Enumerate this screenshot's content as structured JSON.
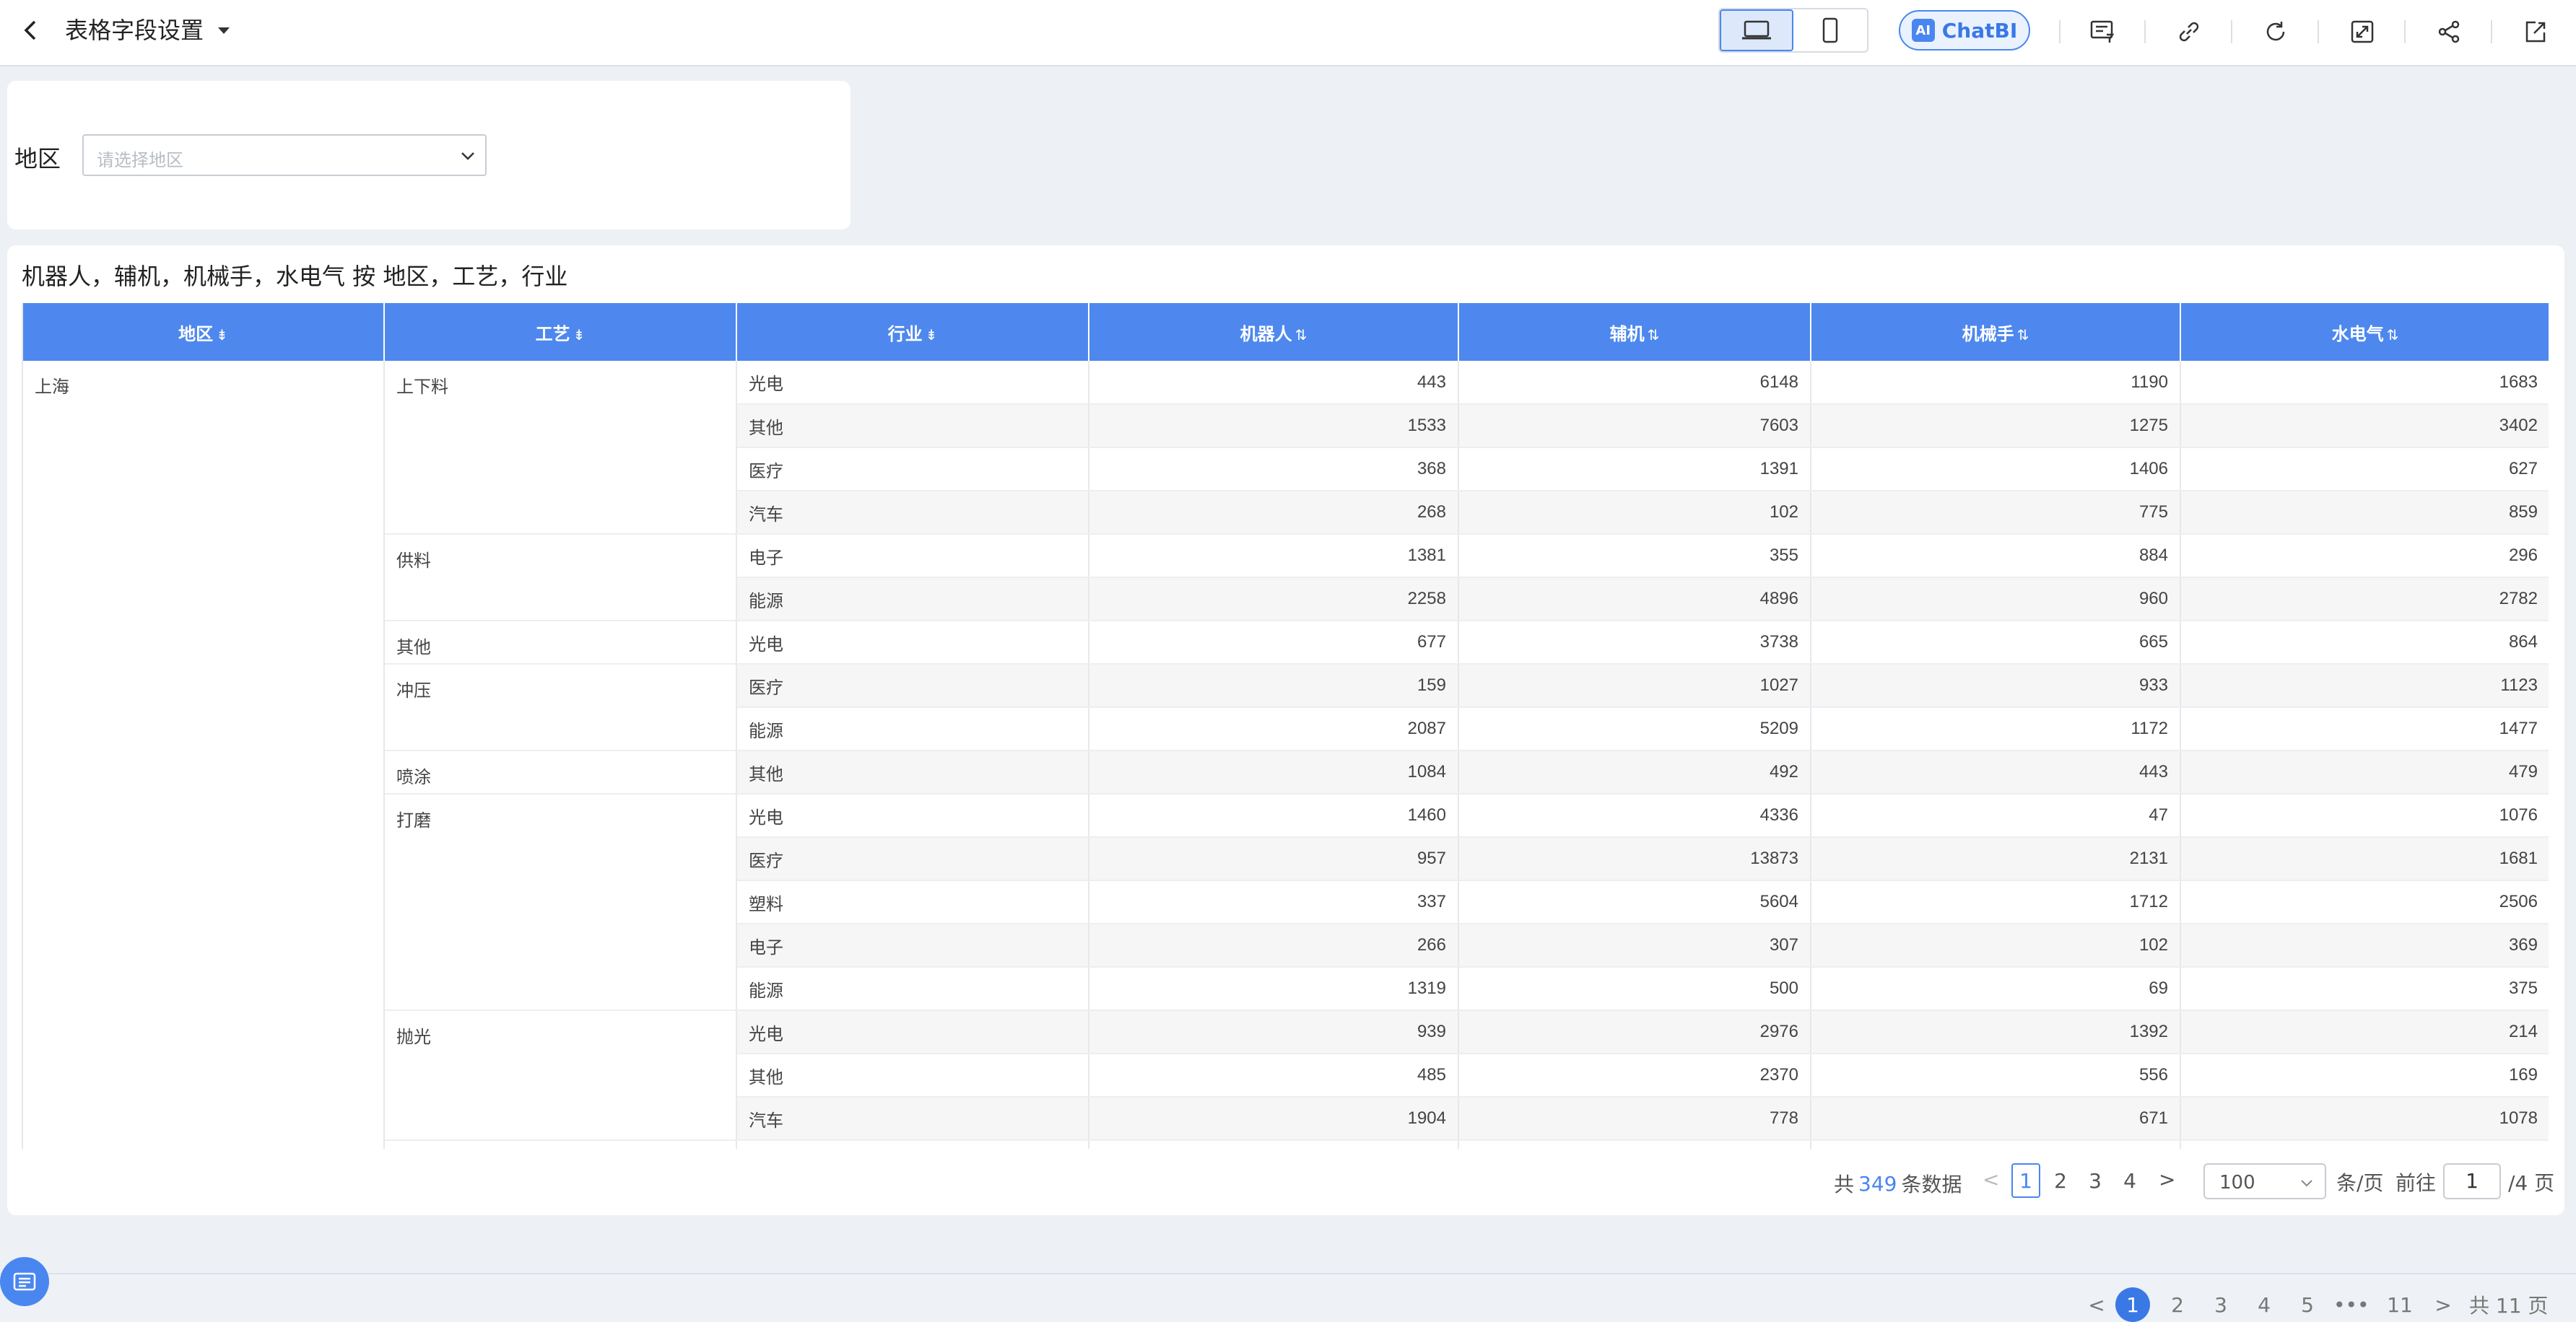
{
  "header": {
    "title": "表格字段设置",
    "chatbi_label": "ChatBI",
    "chatbi_logo": "AI"
  },
  "filter": {
    "label": "地区",
    "placeholder": "请选择地区"
  },
  "table": {
    "title": "机器人，辅机，机械手，水电气 按 地区，工艺，行业",
    "columns": [
      "地区",
      "工艺",
      "行业",
      "机器人",
      "辅机",
      "机械手",
      "水电气"
    ],
    "region": "上海",
    "rows": [
      {
        "process": "上下料",
        "industry": "光电",
        "v": [
          "443",
          "6148",
          "1190",
          "1683"
        ]
      },
      {
        "process": "",
        "industry": "其他",
        "v": [
          "1533",
          "7603",
          "1275",
          "3402"
        ]
      },
      {
        "process": "",
        "industry": "医疗",
        "v": [
          "368",
          "1391",
          "1406",
          "627"
        ]
      },
      {
        "process": "",
        "industry": "汽车",
        "v": [
          "268",
          "102",
          "775",
          "859"
        ]
      },
      {
        "process": "供料",
        "industry": "电子",
        "v": [
          "1381",
          "355",
          "884",
          "296"
        ]
      },
      {
        "process": "",
        "industry": "能源",
        "v": [
          "2258",
          "4896",
          "960",
          "2782"
        ]
      },
      {
        "process": "其他",
        "industry": "光电",
        "v": [
          "677",
          "3738",
          "665",
          "864"
        ]
      },
      {
        "process": "冲压",
        "industry": "医疗",
        "v": [
          "159",
          "1027",
          "933",
          "1123"
        ]
      },
      {
        "process": "",
        "industry": "能源",
        "v": [
          "2087",
          "5209",
          "1172",
          "1477"
        ]
      },
      {
        "process": "喷涂",
        "industry": "其他",
        "v": [
          "1084",
          "492",
          "443",
          "479"
        ]
      },
      {
        "process": "打磨",
        "industry": "光电",
        "v": [
          "1460",
          "4336",
          "47",
          "1076"
        ]
      },
      {
        "process": "",
        "industry": "医疗",
        "v": [
          "957",
          "13873",
          "2131",
          "1681"
        ]
      },
      {
        "process": "",
        "industry": "塑料",
        "v": [
          "337",
          "5604",
          "1712",
          "2506"
        ]
      },
      {
        "process": "",
        "industry": "电子",
        "v": [
          "266",
          "307",
          "102",
          "369"
        ]
      },
      {
        "process": "",
        "industry": "能源",
        "v": [
          "1319",
          "500",
          "69",
          "375"
        ]
      },
      {
        "process": "抛光",
        "industry": "光电",
        "v": [
          "939",
          "2976",
          "1392",
          "214"
        ]
      },
      {
        "process": "",
        "industry": "其他",
        "v": [
          "485",
          "2370",
          "556",
          "169"
        ]
      },
      {
        "process": "",
        "industry": "汽车",
        "v": [
          "1904",
          "778",
          "671",
          "1078"
        ]
      }
    ]
  },
  "pagination": {
    "total_prefix": "共",
    "total_count": "349",
    "total_suffix": "条数据",
    "pages": [
      "1",
      "2",
      "3",
      "4"
    ],
    "page_size": "100",
    "per_page_label": "条/页",
    "goto_label": "前往",
    "current_input": "1",
    "of_label": "/4 页"
  },
  "bottom_pagination": {
    "pages": [
      "1",
      "2",
      "3",
      "4",
      "5"
    ],
    "ellipsis": "•••",
    "last": "11",
    "total": "共 11 页"
  },
  "colors": {
    "accent": "#4a86ef",
    "header_bg": "#4e88ee"
  }
}
